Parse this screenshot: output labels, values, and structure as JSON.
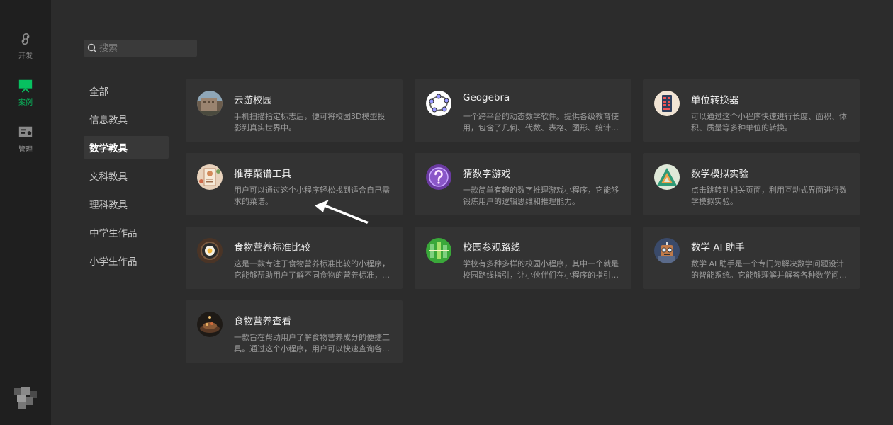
{
  "rail": {
    "items": [
      {
        "label": "开发",
        "icon": "mini-program-icon"
      },
      {
        "label": "案例",
        "icon": "showcase-icon",
        "active": true
      },
      {
        "label": "管理",
        "icon": "manage-icon"
      }
    ]
  },
  "search": {
    "placeholder": "搜索"
  },
  "categories": [
    "全部",
    "信息教具",
    "数学教具",
    "文科教具",
    "理科教具",
    "中学生作品",
    "小学生作品"
  ],
  "selected_category": "数学教具",
  "cards": [
    {
      "title": "云游校园",
      "desc": "手机扫描指定标志后，便可将校园3D模型投影到真实世界中。",
      "icon": "campus-photo-icon"
    },
    {
      "title": "Geogebra",
      "desc": "一个跨平台的动态数学软件。提供各级教育使用，包含了几何、代数、表格、图形、统计…",
      "icon": "geogebra-icon"
    },
    {
      "title": "单位转换器",
      "desc": "可以通过这个小程序快速进行长度、面积、体积、质量等多种单位的转换。",
      "icon": "unit-converter-icon"
    },
    {
      "title": "推荐菜谱工具",
      "desc": "用户可以通过这个小程序轻松找到适合自己需求的菜谱。",
      "icon": "recipe-icon"
    },
    {
      "title": "猜数字游戏",
      "desc": "一款简单有趣的数字推理游戏小程序，它能够锻炼用户的逻辑思维和推理能力。",
      "icon": "question-mark-icon"
    },
    {
      "title": "数学模拟实验",
      "desc": "点击跳转到相关页面，利用互动式界面进行数学模拟实验。",
      "icon": "triangle-icon"
    },
    {
      "title": "食物营养标准比较",
      "desc": "这是一款专注于食物营养标准比较的小程序，它能够帮助用户了解不同食物的营养标准，…",
      "icon": "food-pan-icon"
    },
    {
      "title": "校园参观路线",
      "desc": "学校有多种多样的校园小程序，其中一个就是校园路线指引，让小伙伴们在小程序的指引…",
      "icon": "campus-map-icon"
    },
    {
      "title": "数学 AI 助手",
      "desc": "数学 AI 助手是一个专门为解决数学问题设计的智能系统。它能够理解并解答各种数学问…",
      "icon": "robot-icon"
    },
    {
      "title": "食物营养查看",
      "desc": "一款旨在帮助用户了解食物营养成分的便捷工具。通过这个小程序，用户可以快速查询各…",
      "icon": "food-dish-icon"
    }
  ],
  "colors": {
    "accent": "#07c160",
    "card_bg": "#333333",
    "page_bg": "#2c2c2c",
    "rail_bg": "#1f1f1f"
  }
}
